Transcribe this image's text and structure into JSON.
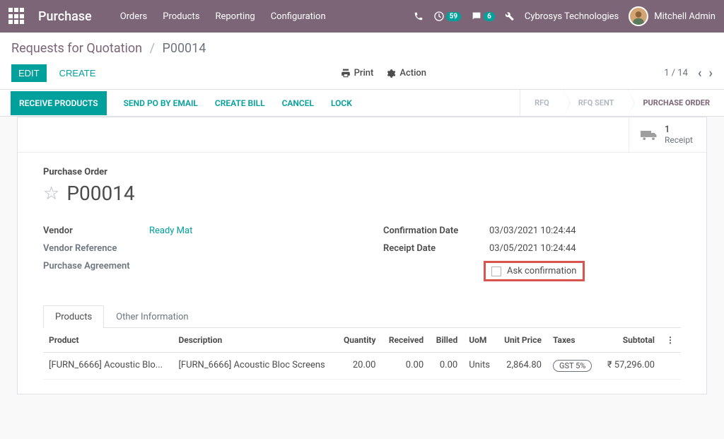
{
  "navbar": {
    "brand": "Purchase",
    "menu": [
      "Orders",
      "Products",
      "Reporting",
      "Configuration"
    ],
    "clock_badge": "59",
    "chat_badge": "6",
    "company": "Cybrosys Technologies",
    "user_name": "Mitchell Admin"
  },
  "breadcrumb": {
    "parent": "Requests for Quotation",
    "current": "P00014"
  },
  "buttons": {
    "edit": "EDIT",
    "create": "CREATE",
    "print": "Print",
    "action": "Action"
  },
  "pager": "1 / 14",
  "statusbar": {
    "receive": "RECEIVE PRODUCTS",
    "send": "SEND PO BY EMAIL",
    "bill": "CREATE BILL",
    "cancel": "CANCEL",
    "lock": "LOCK",
    "stages": [
      "RFQ",
      "RFQ SENT",
      "PURCHASE ORDER"
    ]
  },
  "statbutton": {
    "count": "1",
    "label": "Receipt"
  },
  "form": {
    "title_label": "Purchase Order",
    "name": "P00014",
    "labels": {
      "vendor": "Vendor",
      "vendor_ref": "Vendor Reference",
      "agreement": "Purchase Agreement",
      "confirm_date": "Confirmation Date",
      "receipt_date": "Receipt Date",
      "ask_confirm": "Ask confirmation"
    },
    "values": {
      "vendor": "Ready Mat",
      "confirm_date": "03/03/2021 10:24:44",
      "receipt_date": "03/05/2021 10:24:44"
    }
  },
  "tabs": {
    "products": "Products",
    "other": "Other Information"
  },
  "table": {
    "headers": {
      "product": "Product",
      "description": "Description",
      "quantity": "Quantity",
      "received": "Received",
      "billed": "Billed",
      "uom": "UoM",
      "unit_price": "Unit Price",
      "taxes": "Taxes",
      "subtotal": "Subtotal"
    },
    "row": {
      "product": "[FURN_6666] Acoustic Blo...",
      "description": "[FURN_6666] Acoustic Bloc Screens",
      "quantity": "20.00",
      "received": "0.00",
      "billed": "0.00",
      "uom": "Units",
      "unit_price": "2,864.80",
      "taxes": "GST 5%",
      "subtotal": "₹ 57,296.00"
    }
  }
}
